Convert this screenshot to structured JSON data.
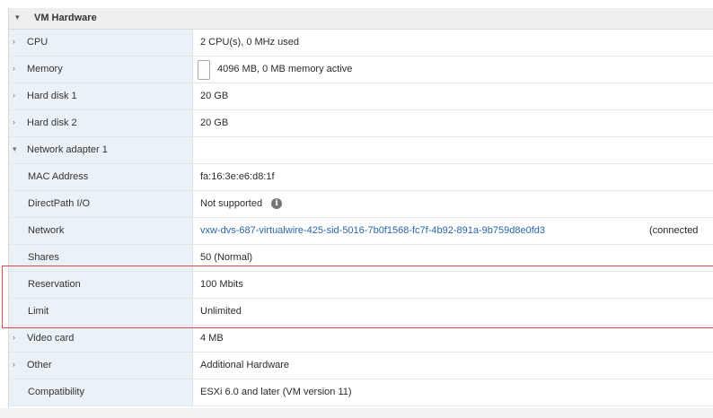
{
  "section": {
    "title": "VM Hardware",
    "collapse_glyph": "▾"
  },
  "rows": [
    {
      "label": "CPU",
      "value": "2 CPU(s), 0 MHz used"
    },
    {
      "label": "Memory",
      "value": "4096 MB, 0 MB memory active"
    },
    {
      "label": "Hard disk 1",
      "value": "20 GB"
    },
    {
      "label": "Hard disk 2",
      "value": "20 GB"
    },
    {
      "label": "Network adapter 1",
      "value": ""
    },
    {
      "label": "MAC Address",
      "value": "fa:16:3e:e6:d8:1f"
    },
    {
      "label": "DirectPath I/O",
      "value": "Not supported"
    },
    {
      "label": "Network",
      "value": "vxw-dvs-687-virtualwire-425-sid-5016-7b0f1568-fc7f-4b92-891a-9b759d8e0fd3",
      "suffix": "(connected"
    },
    {
      "label": "Shares",
      "value": "50 (Normal)"
    },
    {
      "label": "Reservation",
      "value": "100 Mbits"
    },
    {
      "label": "Limit",
      "value": "Unlimited"
    },
    {
      "label": "Video card",
      "value": "4 MB"
    },
    {
      "label": "Other",
      "value": "Additional Hardware"
    },
    {
      "label": "Compatibility",
      "value": "ESXi 6.0 and later (VM version 11)"
    }
  ],
  "icons": {
    "expand": "›",
    "collapse": "▾",
    "info": "i"
  },
  "colors": {
    "highlight": "#e04848",
    "link": "#2a64a8",
    "label_bg": "#eaf2f8"
  }
}
